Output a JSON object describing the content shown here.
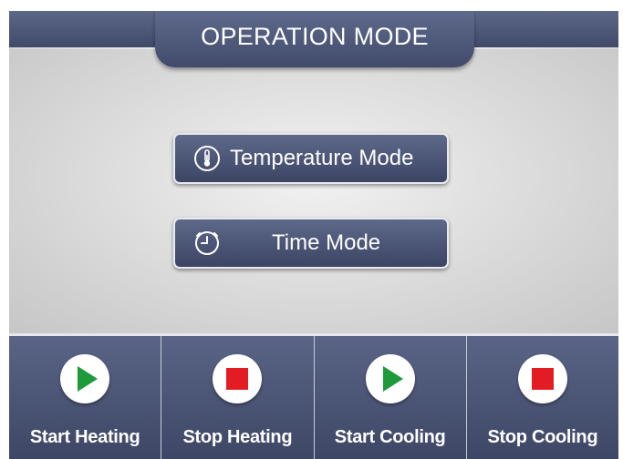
{
  "header": {
    "title": "OPERATION MODE"
  },
  "mode_buttons": [
    {
      "label": "Temperature Mode",
      "icon": "thermometer-icon"
    },
    {
      "label": "Time Mode",
      "icon": "clock-icon"
    }
  ],
  "actions": [
    {
      "label": "Start Heating",
      "icon": "play-icon",
      "color": "#1e9a3a"
    },
    {
      "label": "Stop Heating",
      "icon": "stop-icon",
      "color": "#e31b23"
    },
    {
      "label": "Start Cooling",
      "icon": "play-icon",
      "color": "#1e9a3a"
    },
    {
      "label": "Stop Cooling",
      "icon": "stop-icon",
      "color": "#e31b23"
    }
  ],
  "colors": {
    "panel_navy": "#414a6a",
    "panel_grey": "#d8d8d8",
    "play_green": "#1e9a3a",
    "stop_red": "#e31b23"
  }
}
